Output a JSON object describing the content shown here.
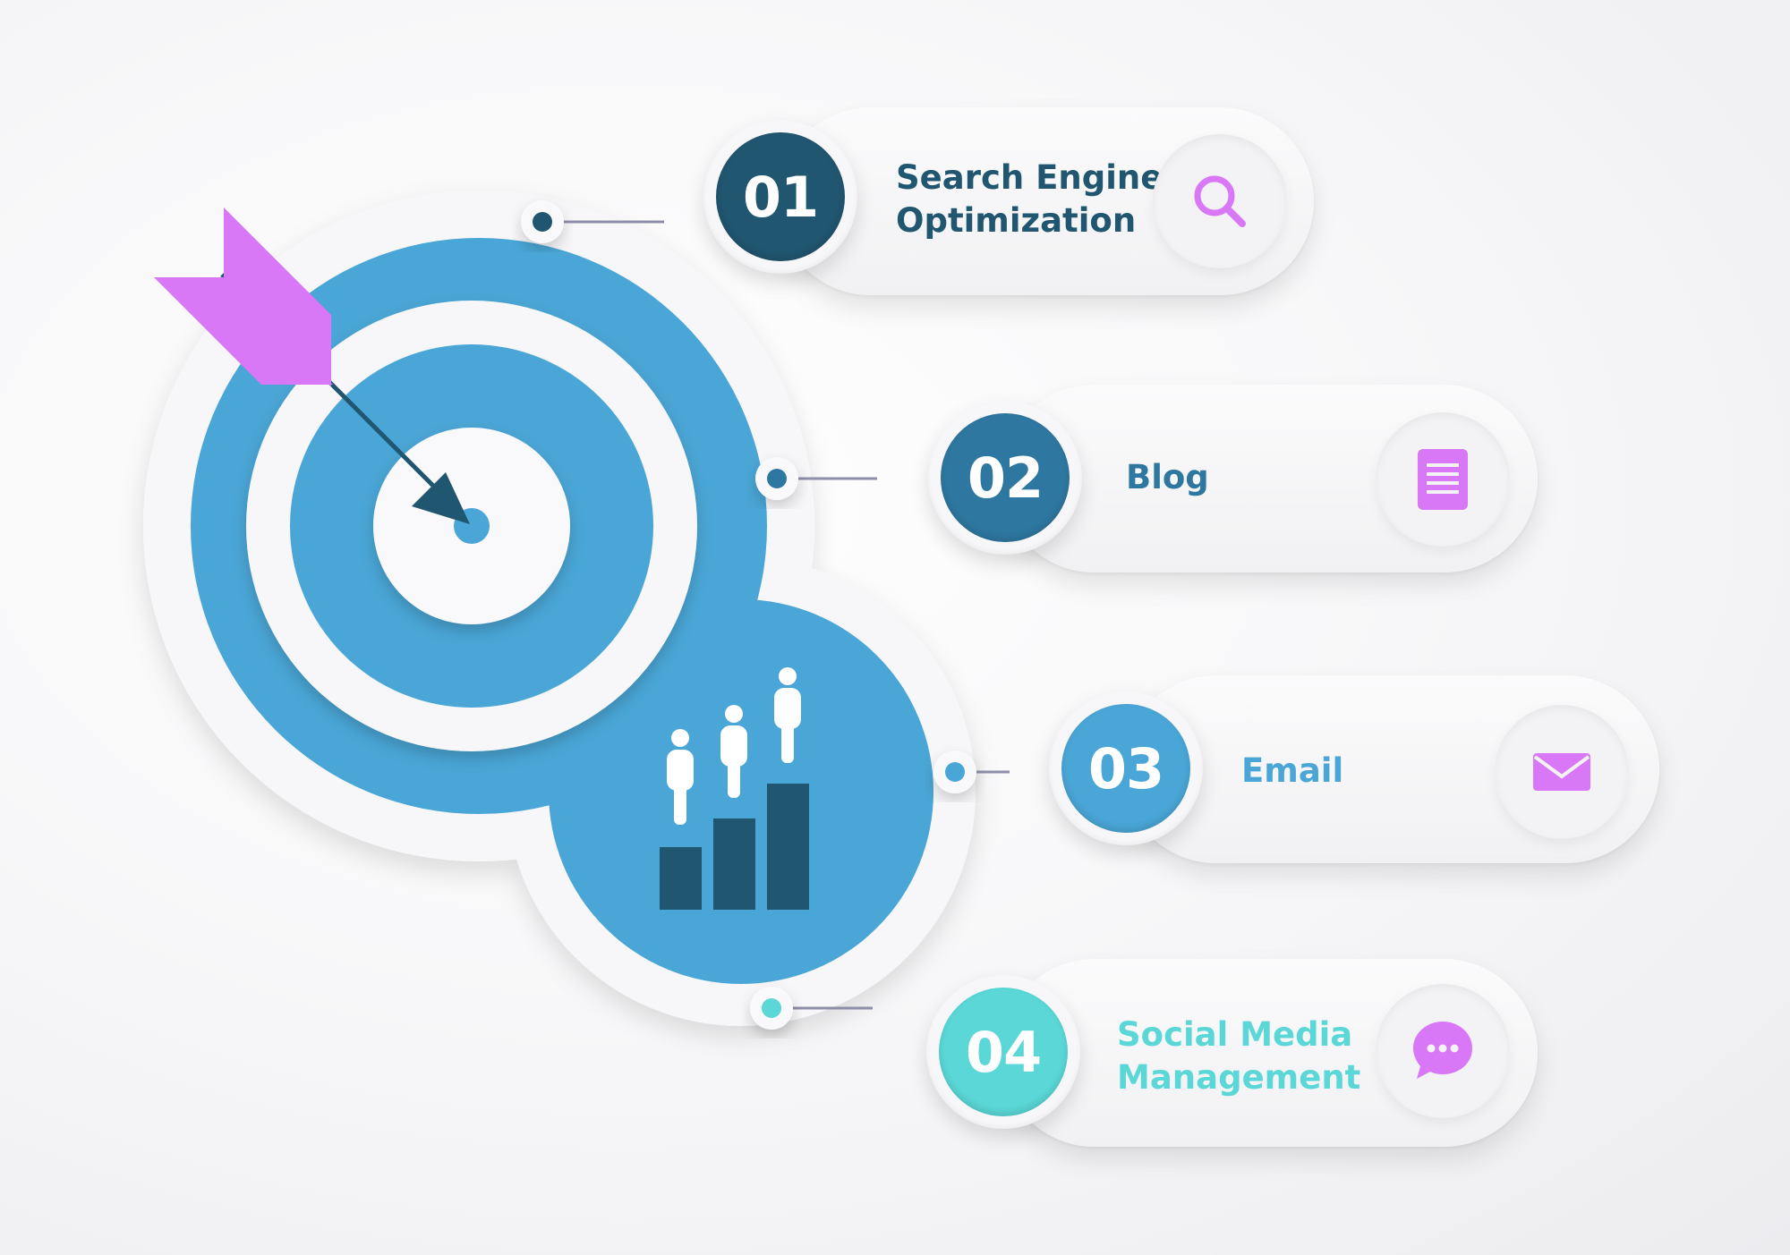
{
  "colors": {
    "blue": "#4aa6d6",
    "teal_dark": "#20566f",
    "teal_mid": "#2e77a0",
    "cyan": "#5ad7d6",
    "magenta": "#d978f6",
    "connector": "#8e8ea8"
  },
  "items": [
    {
      "number": "01",
      "label": "Search Engine\nOptimization",
      "icon": "search-icon"
    },
    {
      "number": "02",
      "label": "Blog",
      "icon": "document-icon"
    },
    {
      "number": "03",
      "label": "Email",
      "icon": "envelope-icon"
    },
    {
      "number": "04",
      "label": "Social Media\nManagement",
      "icon": "chat-bubble-icon"
    }
  ]
}
